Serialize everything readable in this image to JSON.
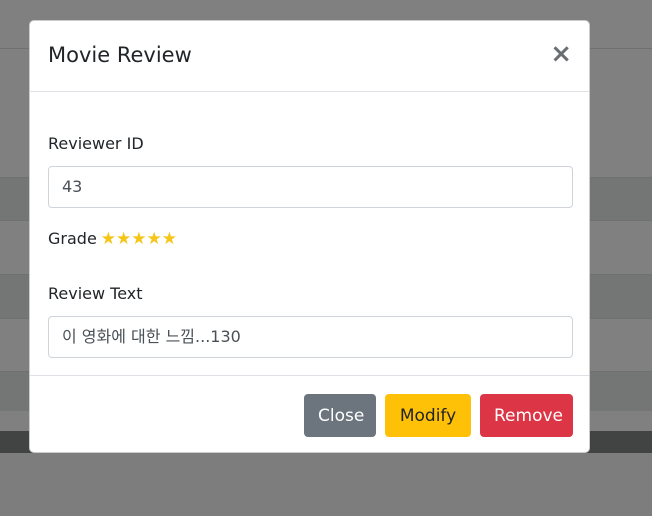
{
  "modal": {
    "title": "Movie Review",
    "close_glyph": "×"
  },
  "form": {
    "reviewer_label": "Reviewer ID",
    "reviewer_value": "43",
    "grade_label": "Grade",
    "grade_stars": "★★★★★",
    "grade_value": 5,
    "review_label": "Review Text",
    "review_value": "이 영화에 대한 느낌...130"
  },
  "footer": {
    "close_label": "Close",
    "modify_label": "Modify",
    "remove_label": "Remove"
  },
  "colors": {
    "star": "#f5c518",
    "close_btn": "#6c757d",
    "modify_btn": "#ffc107",
    "remove_btn": "#dc3545"
  }
}
